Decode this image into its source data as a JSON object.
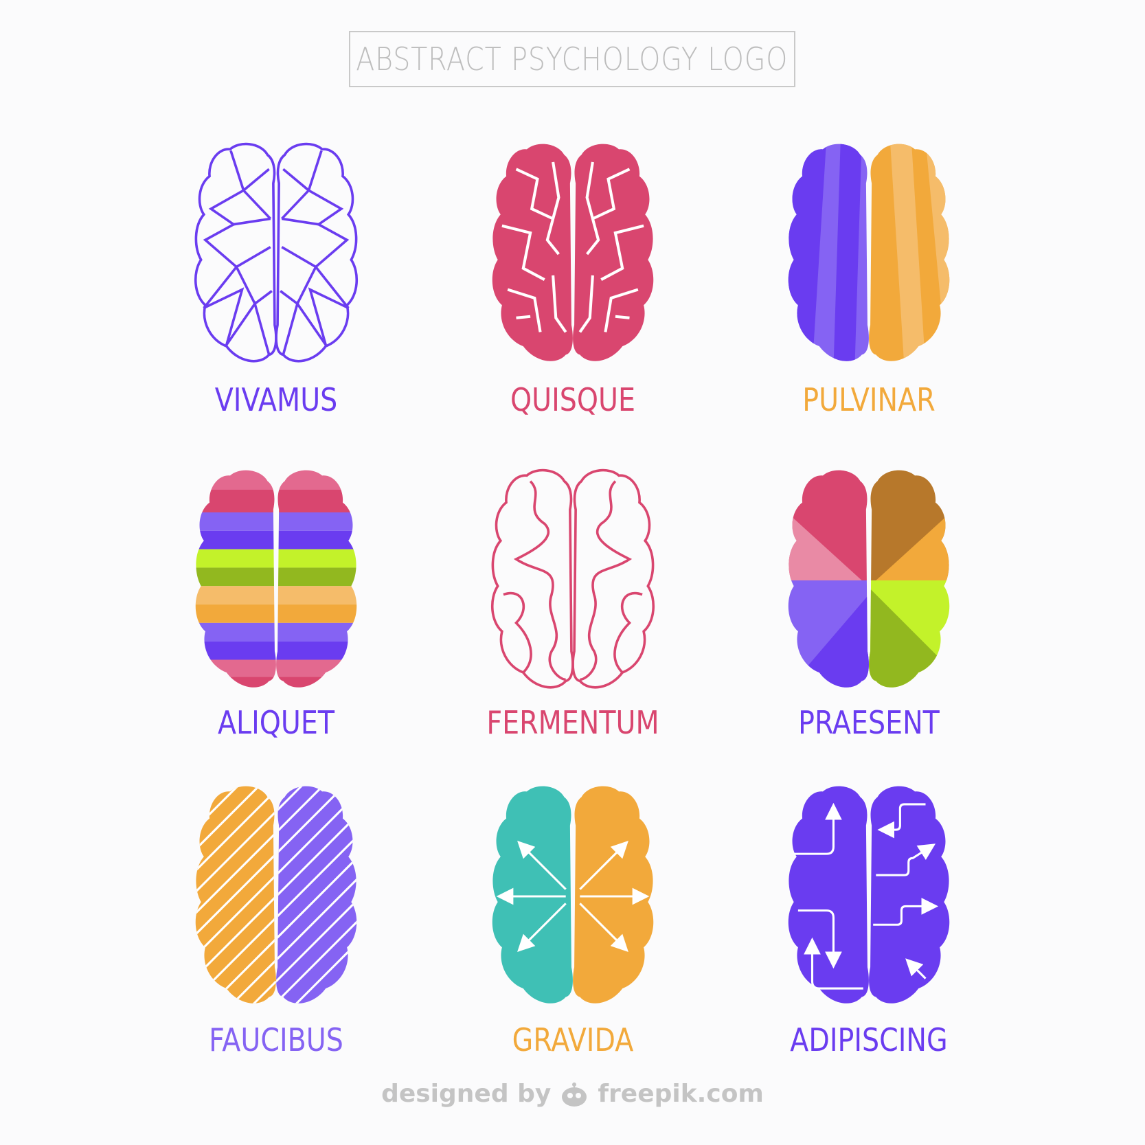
{
  "header": {
    "title": "ABSTRACT PSYCHOLOGY LOGO"
  },
  "logos": [
    {
      "label": "VIVAMUS",
      "color": "#6a3cf0",
      "style": "polygon-outline"
    },
    {
      "label": "QUISQUE",
      "color": "#d9466f",
      "style": "cracked-fill"
    },
    {
      "label": "PULVINAR",
      "color": "#f2a93b",
      "style": "two-tone-halves"
    },
    {
      "label": "ALIQUET",
      "color": "#6a3cf0",
      "style": "rainbow-stripes"
    },
    {
      "label": "FERMENTUM",
      "color": "#d9466f",
      "style": "curvy-outline"
    },
    {
      "label": "PRAESENT",
      "color": "#6a3cf0",
      "style": "quadrant-color"
    },
    {
      "label": "FAUCIBUS",
      "color": "#8563f3",
      "style": "diagonal-hatch"
    },
    {
      "label": "GRAVIDA",
      "color": "#f2a93b",
      "style": "radiating-arrows"
    },
    {
      "label": "ADIPISCING",
      "color": "#6a3cf0",
      "style": "circuit-arrows"
    }
  ],
  "footer": {
    "text": "designed by",
    "brand": "freepik.com",
    "icon": "freepik-icon"
  }
}
